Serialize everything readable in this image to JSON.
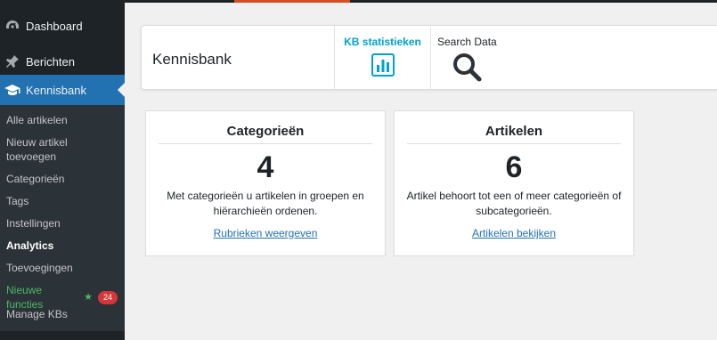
{
  "sidebar": {
    "items": [
      {
        "label": "Dashboard",
        "icon": "dashboard-icon"
      },
      {
        "label": "Berichten",
        "icon": "pin-icon"
      },
      {
        "label": "Kennisbank",
        "icon": "graduation-cap-icon"
      }
    ],
    "submenu": [
      {
        "label": "Alle artikelen"
      },
      {
        "label": "Nieuw artikel toevoegen"
      },
      {
        "label": "Categorieën"
      },
      {
        "label": "Tags"
      },
      {
        "label": "Instellingen"
      },
      {
        "label": "Analytics"
      },
      {
        "label": "Toevoegingen"
      },
      {
        "label": "Nieuwe functies",
        "badge": "24"
      },
      {
        "label": "Manage KBs"
      }
    ]
  },
  "header": {
    "title": "Kennisbank",
    "tab_stats_label": "KB statistieken",
    "tab_search_label": "Search Data"
  },
  "cards": [
    {
      "title": "Categorieën",
      "count": "4",
      "desc": "Met categorieën u artikelen in groepen en hiërarchieën ordenen.",
      "link": "Rubrieken weergeven"
    },
    {
      "title": "Artikelen",
      "count": "6",
      "desc": "Artikel behoort tot een of meer categorieën of subcategorieën.",
      "link": "Artikelen bekijken"
    }
  ],
  "colors": {
    "sidebar_bg": "#1d2327",
    "active_blue": "#2271b1",
    "stats_blue": "#00a0d2",
    "new_features_green": "#4ab866",
    "badge_red": "#d63638"
  }
}
